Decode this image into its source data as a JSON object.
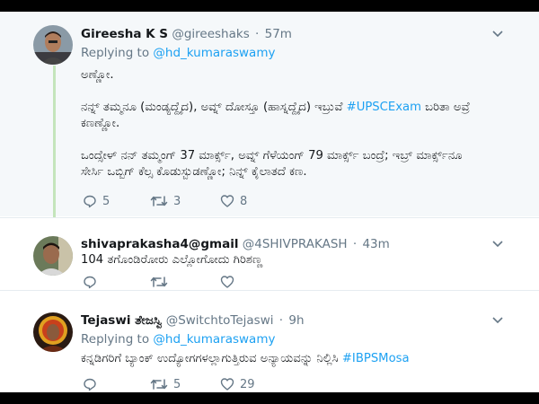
{
  "tweets": [
    {
      "name": "Gireesha K S",
      "handle": "@gireeshaks",
      "time": "57m",
      "replying_prefix": "Replying to",
      "replying_to": "@hd_kumaraswamy",
      "p1": "ಅಣ್ಣೋ.",
      "p2a": "ನನ್ನ್ ತಮ್ಮನೂ (ಮಂಡ್ಯದ್ದೈದ), ಅವ್ನ್ ದೋಸ್ತೂ (ಹಾಸ್ನದ್ದೈದ) ಇಬ್ರುವೆ ",
      "hashtag": "#UPSCExam",
      "p2b": " ಬರಿತಾ ಅವ್ರೆ",
      "p2c": "ಕಣಣ್ಣೋ.",
      "p3a": "ಒಂದ್ಸೇಳ್ ನನ್ ತಮ್ಮಂಗ್ 37 ಮಾರ್ಕ್ಸ್, ಅವ್ನ್ ಗೆಳೆಯಂಗ್ 79 ಮಾರ್ಕ್ಸ್ ಬಂದ್ರೆ; ಇಬ್ರ್ ಮಾರ್ಕ್ಸ್‌ನೂ",
      "p3b": "ಸೇರ್ಸಿ ಒಬ್ಬಿಗ್ ಕೆಲ್ಸ ಕೊಡುಸ್ಬುಡಣ್ಣೋ; ನಿನ್ನ್ ಕೈಲಾತದೆ ಕಣ.",
      "replies": "5",
      "retweets": "3",
      "likes": "8"
    },
    {
      "name": "shivaprakasha4@gmail",
      "handle": "@4SHIVPRAKASH",
      "time": "43m",
      "text": "104 ತಗೊಂಡಿರೋರು ಎಲ್ಲೋಗೋದು ಗಿರಿಶಣ್ಣ"
    },
    {
      "name": "Tejaswi ತೇಜಸ್ವಿ",
      "handle": "@SwitchtoTejaswi",
      "time": "9h",
      "replying_prefix": "Replying to",
      "replying_to": "@hd_kumaraswamy",
      "text": "ಕನ್ನಡಿಗರಿಗೆ ಬ್ಯಾಂಕ್ ಉದ್ಯೋಗಗಳಲ್ಲಾಗುತ್ತಿರುವ ಅನ್ಯಾಯವನ್ನು ನಿಲ್ಲಿಸಿ ",
      "hashtag": "#IBPSMosa",
      "retweets": "5",
      "likes": "29"
    }
  ],
  "separator": "·",
  "icons": {
    "reply": "reply-icon",
    "retweet": "retweet-icon",
    "like": "heart-icon",
    "more": "chevron-down-icon"
  },
  "colors": {
    "link": "#1da1f2",
    "muted": "#657786",
    "thread_line": "#c4e5bb"
  }
}
